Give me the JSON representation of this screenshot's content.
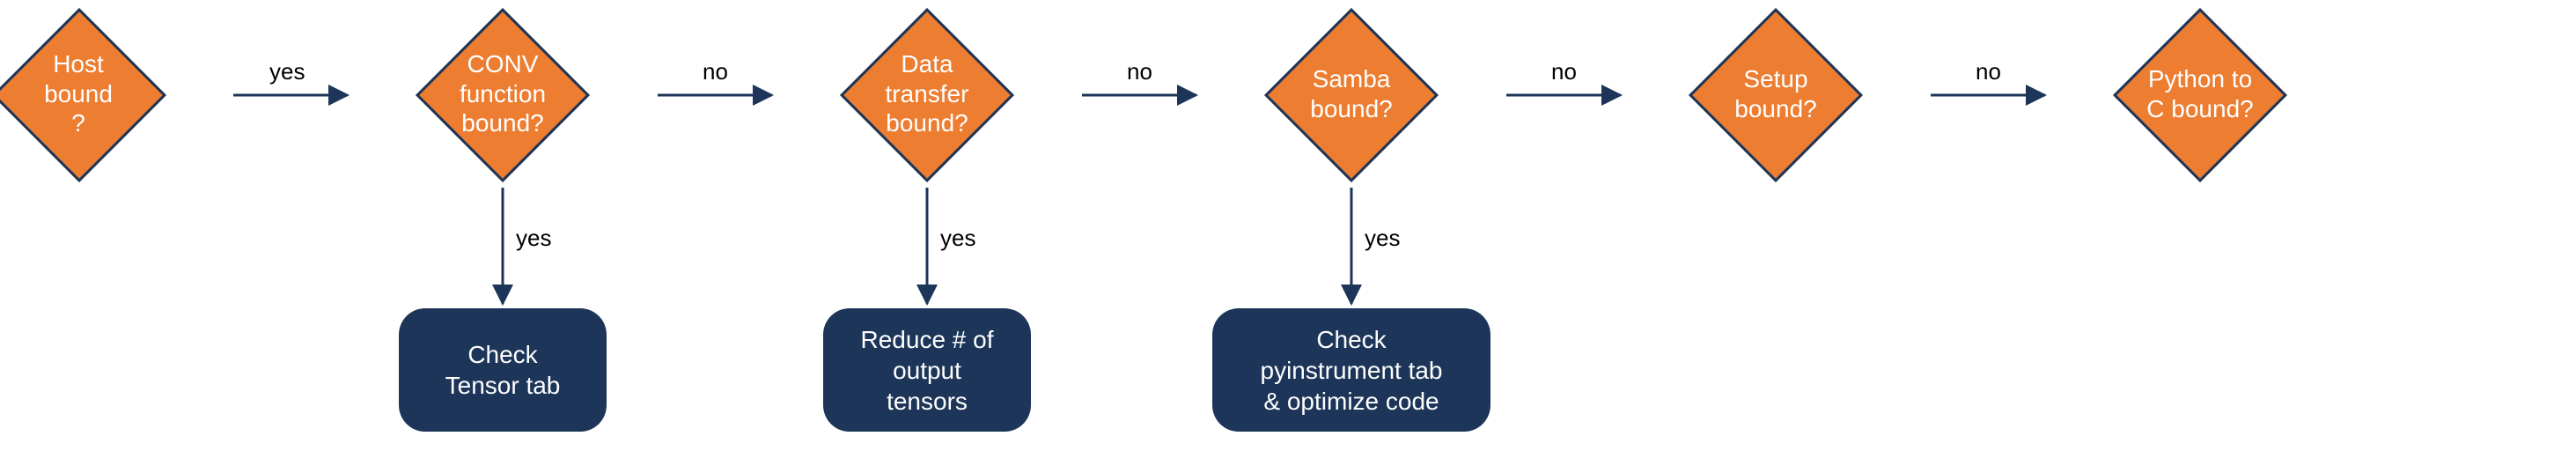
{
  "chart_data": {
    "type": "flowchart",
    "nodes": [
      {
        "id": "host",
        "kind": "decision",
        "label": "Host bound ?"
      },
      {
        "id": "conv",
        "kind": "decision",
        "label": "CONV function bound?"
      },
      {
        "id": "data",
        "kind": "decision",
        "label": "Data transfer bound?"
      },
      {
        "id": "samba",
        "kind": "decision",
        "label": "Samba bound?"
      },
      {
        "id": "setup",
        "kind": "decision",
        "label": "Setup bound?"
      },
      {
        "id": "python",
        "kind": "decision",
        "label": "Python to C bound?"
      },
      {
        "id": "tensor",
        "kind": "action",
        "label": "Check Tensor tab"
      },
      {
        "id": "reduce",
        "kind": "action",
        "label": "Reduce # of output tensors"
      },
      {
        "id": "pyinst",
        "kind": "action",
        "label": "Check pyinstrument tab & optimize code"
      }
    ],
    "edges": [
      {
        "from": "host",
        "to": "conv",
        "label": "yes"
      },
      {
        "from": "conv",
        "to": "data",
        "label": "no"
      },
      {
        "from": "conv",
        "to": "tensor",
        "label": "yes"
      },
      {
        "from": "data",
        "to": "samba",
        "label": "no"
      },
      {
        "from": "data",
        "to": "reduce",
        "label": "yes"
      },
      {
        "from": "samba",
        "to": "setup",
        "label": "no"
      },
      {
        "from": "samba",
        "to": "pyinst",
        "label": "yes"
      },
      {
        "from": "setup",
        "to": "python",
        "label": "no"
      }
    ]
  },
  "labels": {
    "yes": "yes",
    "no": "no"
  },
  "decisions": {
    "host": "Host\nbound\n?",
    "conv": "CONV\nfunction\nbound?",
    "data": "Data\ntransfer\nbound?",
    "samba": "Samba\nbound?",
    "setup": "Setup\nbound?",
    "python": "Python to\nC bound?"
  },
  "actions": {
    "tensor": "Check\nTensor tab",
    "reduce": "Reduce # of\noutput\ntensors",
    "pyinst": "Check\npyinstrument tab\n& optimize code"
  },
  "colors": {
    "decision_fill": "#ed7d31",
    "decision_stroke": "#1c3558",
    "action_fill": "#1c3558",
    "text_dark": "#000000",
    "text_light": "#ffffff"
  }
}
